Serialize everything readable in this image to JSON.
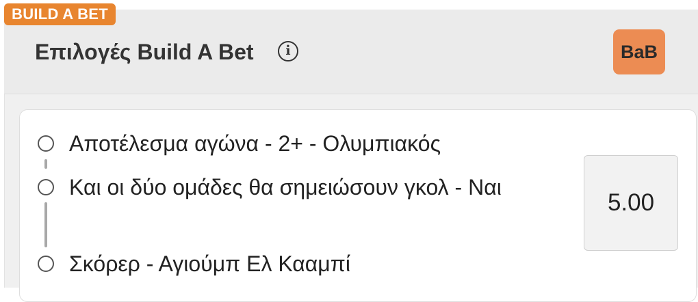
{
  "badge": {
    "label": "BUILD A BET"
  },
  "header": {
    "title": "Επιλογές Build A Bet",
    "info_icon": "info-circle-icon",
    "bab_button_label": "BaB"
  },
  "selections": [
    {
      "label": "Αποτέλεσμα αγώνα - 2+ - Ολυμπιακός"
    },
    {
      "label": "Και οι δύο ομάδες θα σημειώσουν γκολ - Ναι"
    },
    {
      "label": "Σκόρερ - Αγιούμπ Ελ Κααμπί"
    }
  ],
  "odds": {
    "value": "5.00"
  },
  "colors": {
    "accent": "#e8852f",
    "bab_button": "#ec8c53",
    "header_bg": "#ebebeb"
  }
}
